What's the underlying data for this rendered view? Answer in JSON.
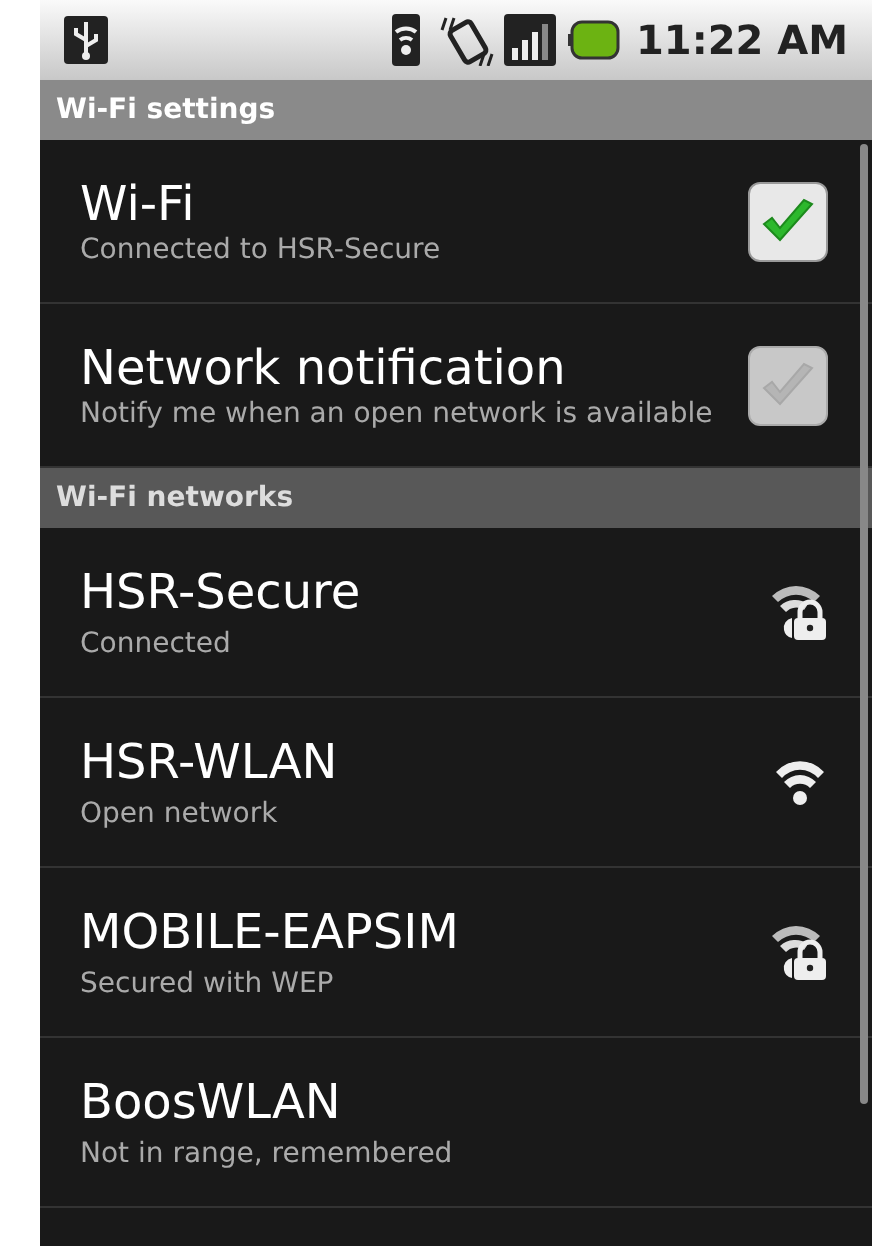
{
  "status_bar": {
    "time": "11:22 AM"
  },
  "settings_header": "Wi-Fi settings",
  "settings": [
    {
      "title": "Wi-Fi",
      "summary": "Connected to HSR-Secure",
      "checked": true,
      "disabled": false
    },
    {
      "title": "Network notification",
      "summary": "Notify me when an open network is available",
      "checked": true,
      "disabled": true
    }
  ],
  "networks_header": "Wi-Fi networks",
  "networks": [
    {
      "name": "HSR-Secure",
      "status": "Connected",
      "kind": "secured"
    },
    {
      "name": "HSR-WLAN",
      "status": "Open network",
      "kind": "open"
    },
    {
      "name": "MOBILE-EAPSIM",
      "status": "Secured with WEP",
      "kind": "secured"
    },
    {
      "name": "BoosWLAN",
      "status": "Not in range, remembered",
      "kind": "absent"
    }
  ]
}
